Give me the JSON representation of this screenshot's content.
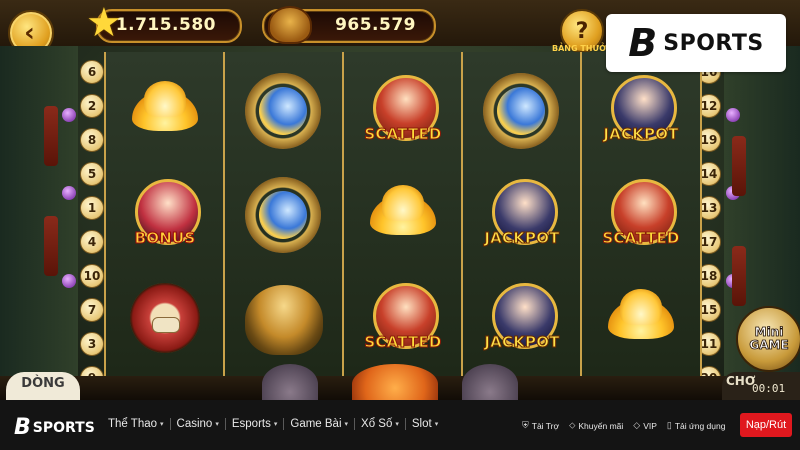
{
  "hud": {
    "balance": "1.715.580",
    "jackpot": "965.579",
    "help_label": "BẢNG THƯỞNG"
  },
  "brand": {
    "name": "SPORTS",
    "mark": "B"
  },
  "paylines": {
    "left": [
      "6",
      "2",
      "8",
      "5",
      "1",
      "4",
      "10",
      "7",
      "3",
      "9"
    ],
    "right": [
      "16",
      "12",
      "19",
      "14",
      "13",
      "17",
      "18",
      "15",
      "11",
      "20"
    ]
  },
  "reels": [
    [
      {
        "symbol": "lotus"
      },
      {
        "symbol": "bonus-hero",
        "label": "BONUS"
      },
      {
        "symbol": "drum"
      }
    ],
    [
      {
        "symbol": "mirror"
      },
      {
        "symbol": "mirror"
      },
      {
        "symbol": "hat"
      }
    ],
    [
      {
        "symbol": "scatter-hero",
        "label": "SCATTED"
      },
      {
        "symbol": "lotus"
      },
      {
        "symbol": "scatter-hero",
        "label": "SCATTED"
      }
    ],
    [
      {
        "symbol": "mirror"
      },
      {
        "symbol": "jackpot-hero",
        "label": "JACKPOT"
      },
      {
        "symbol": "jackpot-hero",
        "label": "JACKPOT"
      }
    ],
    [
      {
        "symbol": "jackpot-hero",
        "label": "JACKPOT"
      },
      {
        "symbol": "scatter-hero",
        "label": "SCATTED"
      },
      {
        "symbol": "lotus"
      }
    ]
  ],
  "bottom": {
    "lines_label": "DÒNG",
    "mini_game": "Mini\nGAME",
    "choi_label": "CHƠ",
    "clock": "00:01"
  },
  "navbar": {
    "logo_mark": "B",
    "logo_text": "SPORTS",
    "menu": [
      "Thể Thao",
      "Casino",
      "Esports",
      "Game Bài",
      "Xổ Số",
      "Slot"
    ],
    "links": [
      {
        "icon": "shield-icon",
        "label": "Tài Trợ"
      },
      {
        "icon": "tag-icon",
        "label": "Khuyến mãi"
      },
      {
        "icon": "diamond-icon",
        "label": "VIP"
      },
      {
        "icon": "phone-icon",
        "label": "Tải ứng dụng"
      }
    ],
    "deposit": "Nạp/Rút"
  },
  "colors": {
    "deposit_button": "#e0181e",
    "hud_value": "#fff6c0"
  }
}
